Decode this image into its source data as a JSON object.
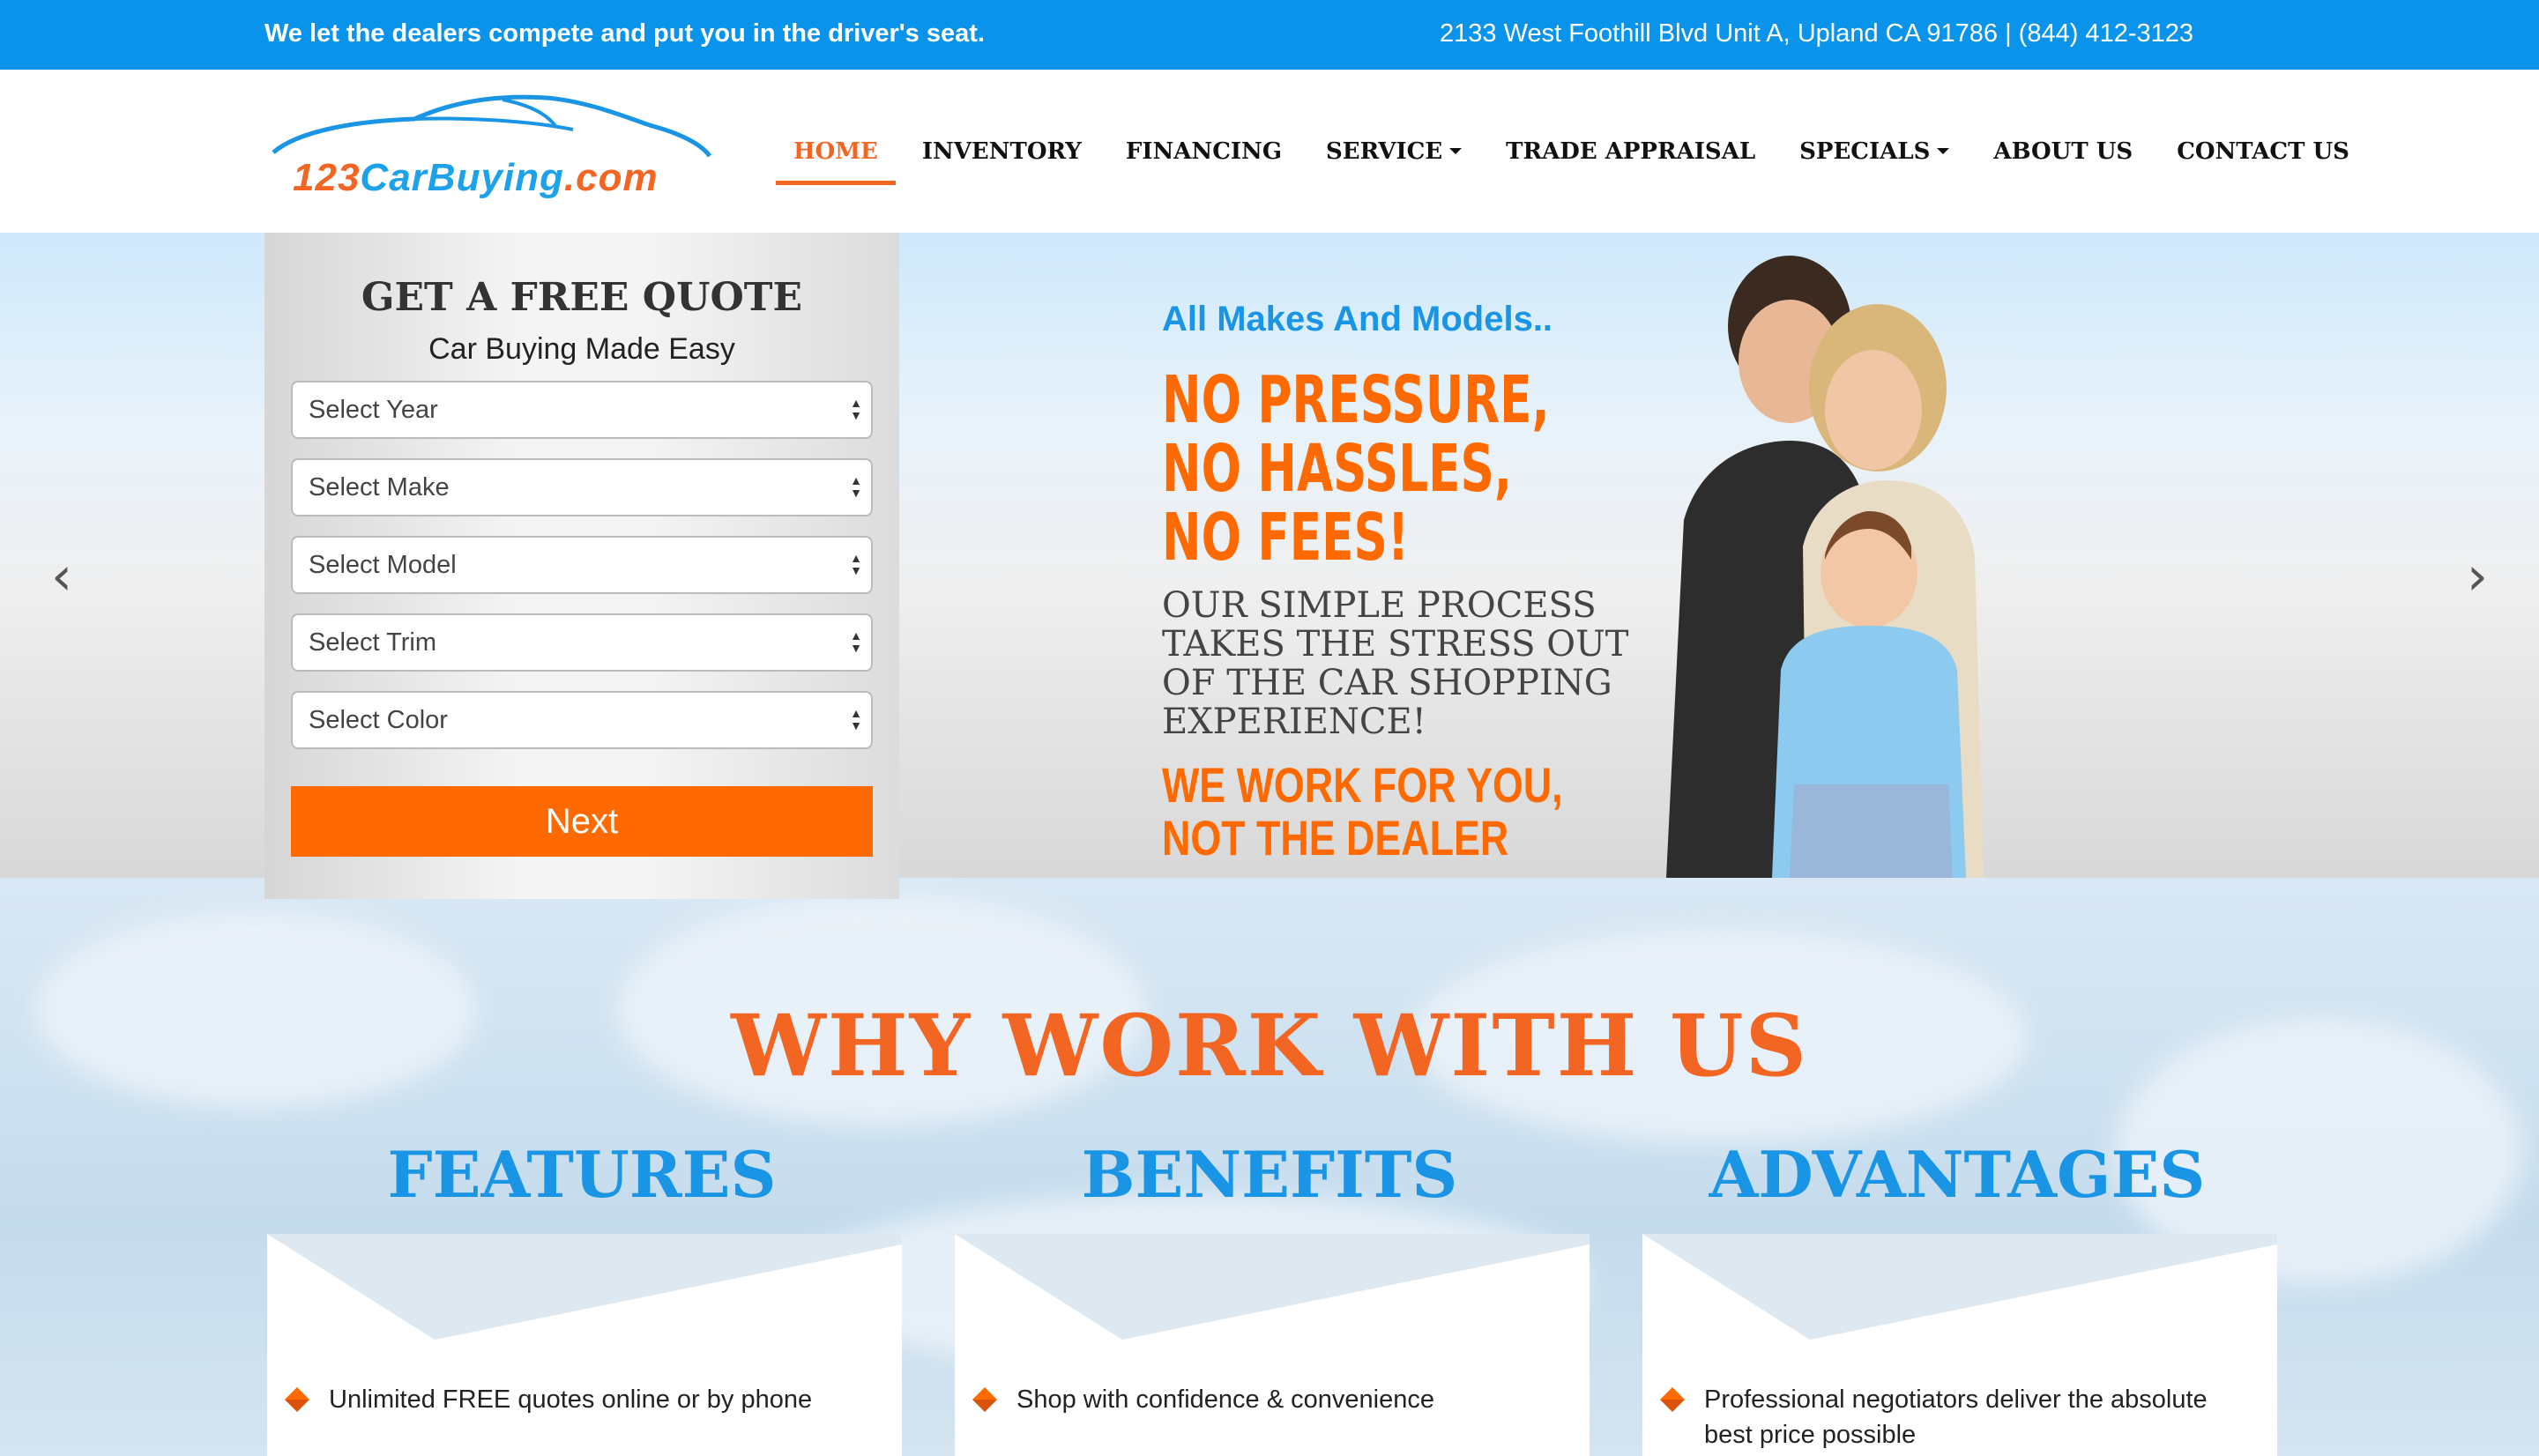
{
  "topbar": {
    "tagline": "We let the dealers compete and put you in the driver's seat.",
    "address": "2133 West Foothill Blvd Unit A, Upland CA 91786 | (844) 412-3123"
  },
  "logo": {
    "num": "123",
    "name": "CarBuying",
    "domain": ".com"
  },
  "nav": {
    "home": "HOME",
    "inventory": "INVENTORY",
    "financing": "FINANCING",
    "service": "SERVICE",
    "trade": "TRADE APPRAISAL",
    "specials": "SPECIALS",
    "about": "ABOUT US",
    "contact": "CONTACT US"
  },
  "quote": {
    "title": "GET A FREE QUOTE",
    "subtitle": "Car Buying Made Easy",
    "year": "Select Year",
    "make": "Select Make",
    "model": "Select Model",
    "trim": "Select Trim",
    "color": "Select Color",
    "next": "Next"
  },
  "hero": {
    "line1": "All Makes And Models..",
    "line2": "NO PRESSURE, NO HASSLES, NO FEES!",
    "line3": "OUR SIMPLE PROCESS TAKES THE STRESS OUT OF THE CAR SHOPPING EXPERIENCE!",
    "line4": "WE WORK FOR YOU, NOT THE DEALER"
  },
  "why": {
    "heading": "WHY WORK WITH US",
    "features": "FEATURES",
    "benefits": "BENEFITS",
    "advantages": "ADVANTAGES",
    "features_item": "Unlimited FREE quotes online or by phone",
    "benefits_item": "Shop with confidence & convenience",
    "advantages_item": "Professional negotiators deliver the absolute best price possible"
  },
  "colors": {
    "brand_blue": "#0a93ea",
    "brand_orange": "#f26522",
    "button_orange": "#ff6a00"
  }
}
